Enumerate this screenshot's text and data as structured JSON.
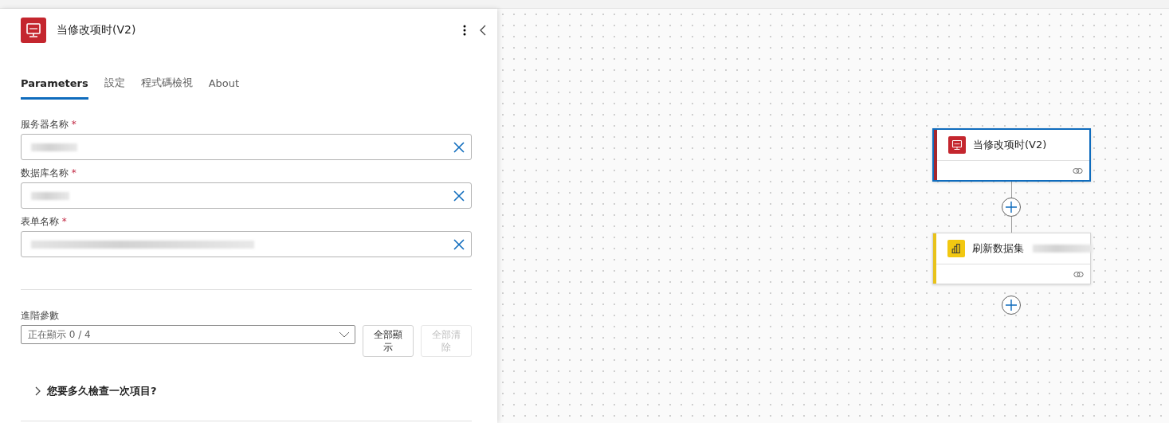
{
  "panel": {
    "title": "当修改项时(V2)",
    "tabs": [
      {
        "label": "Parameters",
        "selected": true
      },
      {
        "label": "設定",
        "selected": false
      },
      {
        "label": "程式碼檢視",
        "selected": false
      },
      {
        "label": "About",
        "selected": false
      }
    ],
    "fields": [
      {
        "label": "服务器名称",
        "required_mark": "*"
      },
      {
        "label": "数据库名称",
        "required_mark": "*"
      },
      {
        "label": "表单名称",
        "required_mark": "*"
      }
    ],
    "advanced": {
      "label": "進階參數",
      "select_value": "正在顯示 0 / 4",
      "buttons": [
        {
          "label": "全部顯示",
          "disabled": false
        },
        {
          "label": "全部清除",
          "disabled": true
        }
      ]
    },
    "section": {
      "label": "您要多久檢查一次項目?",
      "expanded": false
    }
  },
  "canvas": {
    "nodes": [
      {
        "kind": "sql",
        "title": "当修改项时(V2)",
        "selected": true,
        "color": "#a4262c"
      },
      {
        "kind": "powerbi",
        "title": "刷新数据集",
        "selected": false,
        "color": "#e8c21a"
      }
    ]
  }
}
